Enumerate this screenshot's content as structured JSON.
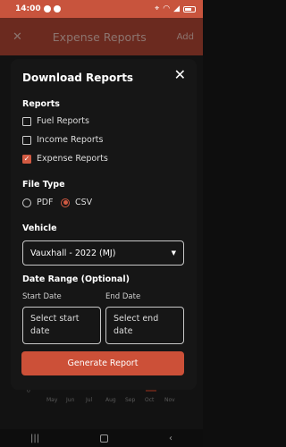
{
  "status_bar": {
    "time": "14:00"
  },
  "app_header": {
    "close_glyph": "✕",
    "title": "Expense Reports",
    "add_label": "Add"
  },
  "background_chart": {
    "zero_label": "0",
    "months": [
      "May",
      "Jun",
      "Jul",
      "Aug",
      "Sep",
      "Oct",
      "Nov"
    ]
  },
  "dialog": {
    "title": "Download Reports",
    "close_glyph": "✕",
    "reports_label": "Reports",
    "reports": [
      {
        "label": "Fuel Reports",
        "checked": false
      },
      {
        "label": "Income Reports",
        "checked": false
      },
      {
        "label": "Expense Reports",
        "checked": true
      }
    ],
    "file_type_label": "File Type",
    "file_types": [
      {
        "label": "PDF",
        "selected": false
      },
      {
        "label": "CSV",
        "selected": true
      }
    ],
    "vehicle_label": "Vehicle",
    "vehicle_value": "Vauxhall - 2022 (MJ)",
    "date_range_label": "Date Range (Optional)",
    "start_date_label": "Start Date",
    "end_date_label": "End Date",
    "start_date_placeholder": "Select start date",
    "end_date_placeholder": "Select end date",
    "generate_label": "Generate Report"
  },
  "colors": {
    "accent": "#cc5038",
    "status_bar": "#c8543d",
    "dialog_bg": "#161616"
  },
  "nav_bar": {
    "recents_glyph": "|||",
    "back_glyph": "‹"
  }
}
